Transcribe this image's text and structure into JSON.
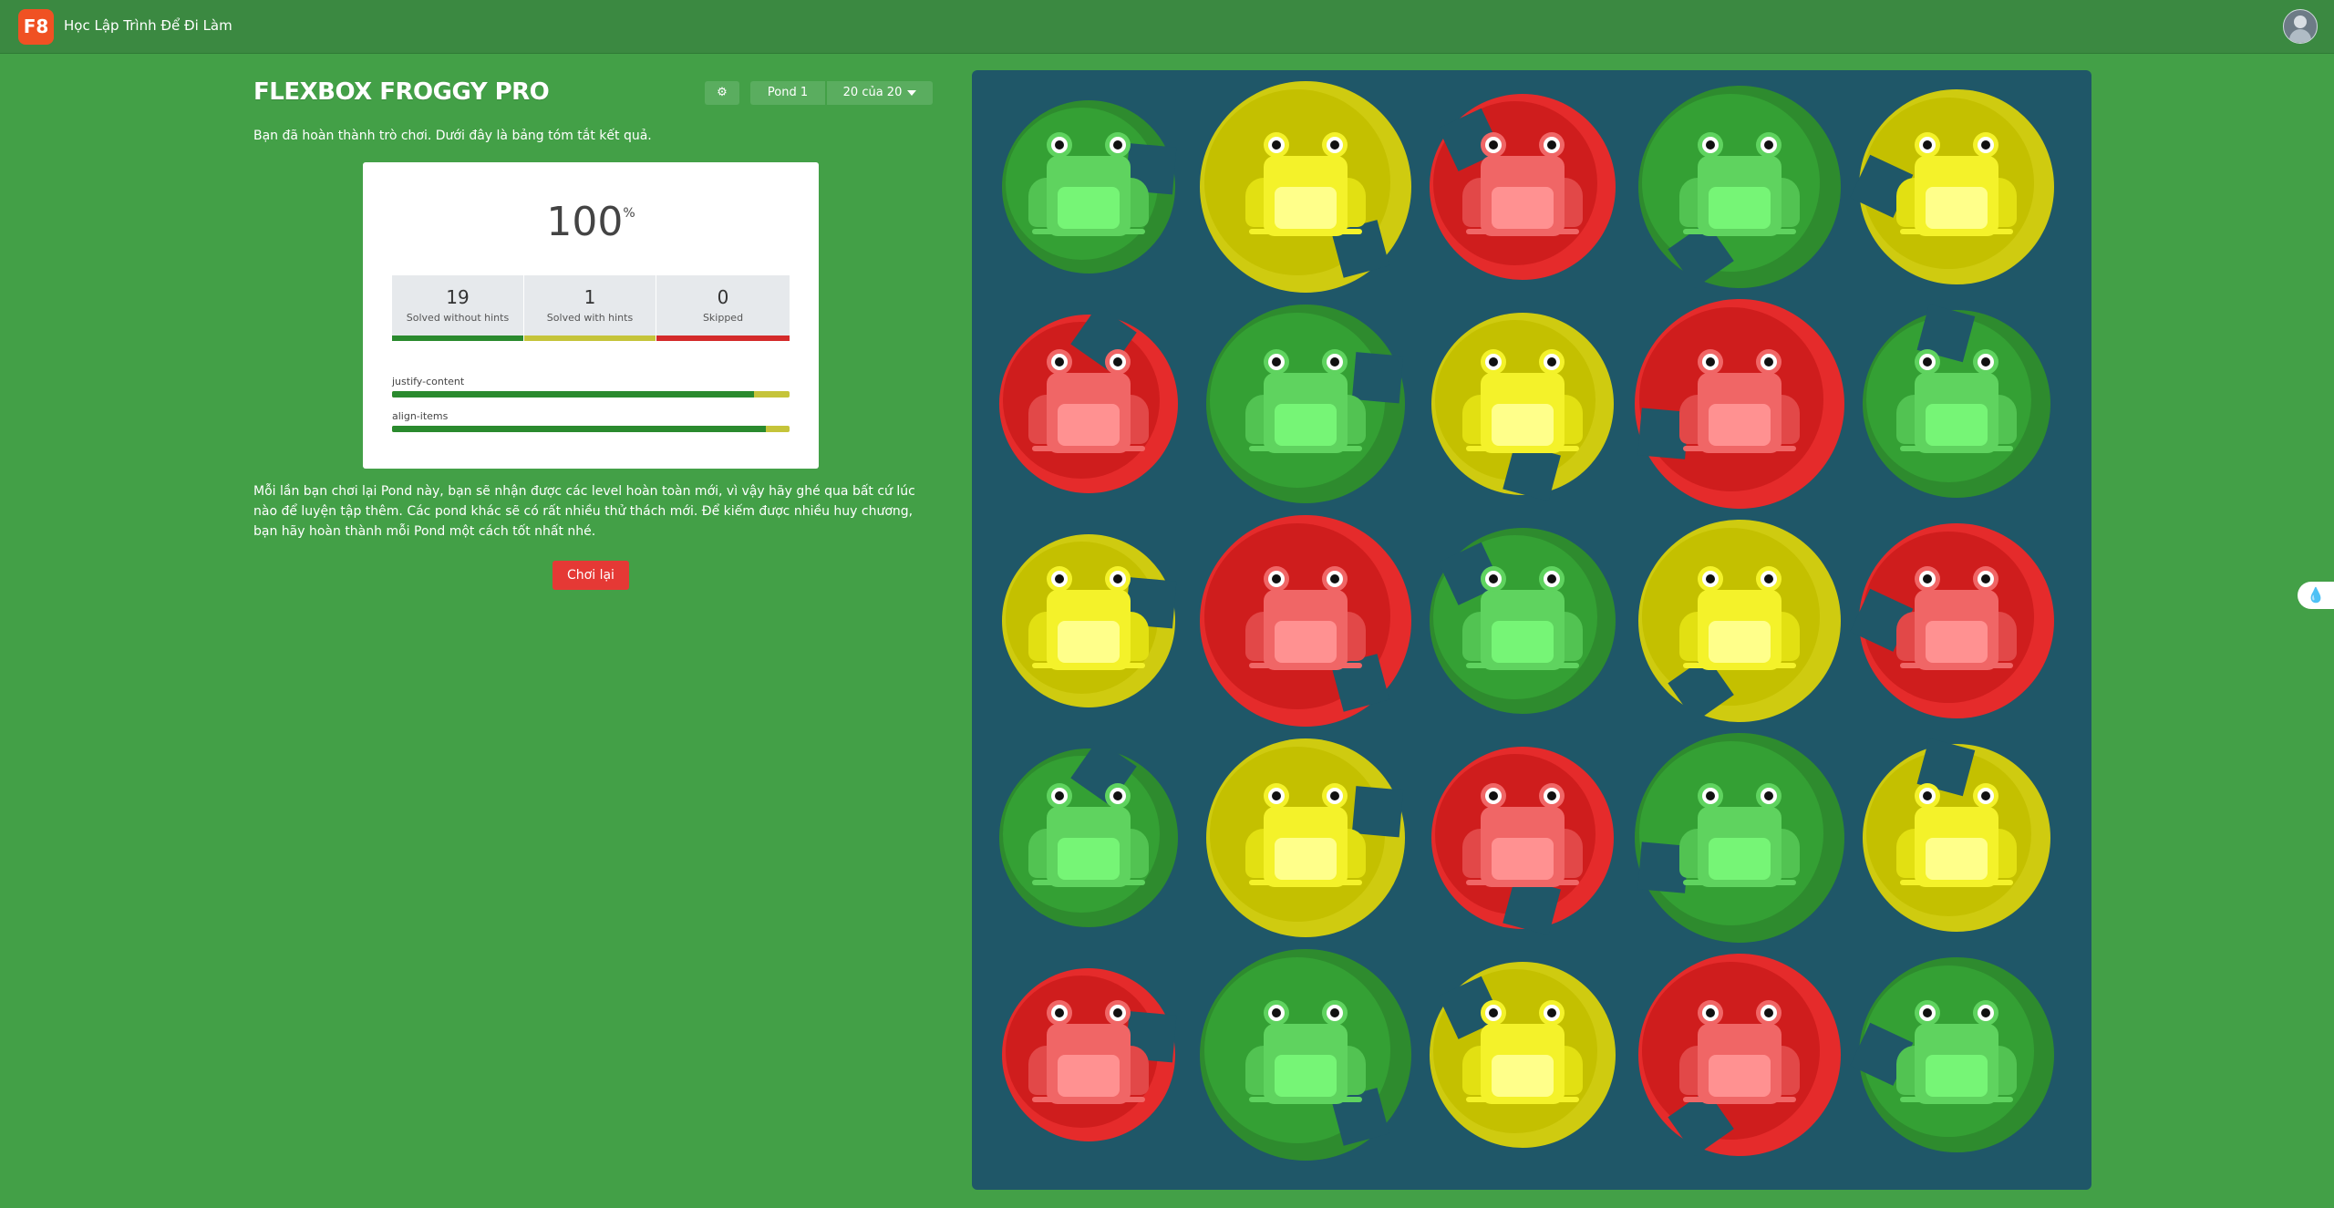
{
  "header": {
    "logo": "F8",
    "site_title": "Học Lập Trình Để Đi Làm"
  },
  "game": {
    "title": "FLEXBOX FROGGY PRO",
    "gear_icon": "⚙",
    "pond_label": "Pond 1",
    "level_label": "20 của 20",
    "intro": "Bạn đã hoàn thành trò chơi. Dưới đây là bảng tóm tắt kết quả.",
    "outro": "Mỗi lần bạn chơi lại Pond này, bạn sẽ nhận được các level hoàn toàn mới, vì vậy hãy ghé qua bất cứ lúc nào để luyện tập thêm. Các pond khác sẽ có rất nhiều thử thách mới. Để kiếm được nhiều huy chương, bạn hãy hoàn thành mỗi Pond một cách tốt nhất nhé.",
    "replay": "Chơi lại"
  },
  "results": {
    "score": "100",
    "score_unit": "%",
    "stats": [
      {
        "value": "19",
        "label": "Solved without hints",
        "color": "#2a8a2e"
      },
      {
        "value": "1",
        "label": "Solved with hints",
        "color": "#c5c43a"
      },
      {
        "value": "0",
        "label": "Skipped",
        "color": "#d42a2a"
      }
    ],
    "properties": [
      {
        "name": "justify-content",
        "fraction_no_hints": 0.91
      },
      {
        "name": "align-items",
        "fraction_no_hints": 0.94
      }
    ]
  },
  "pond": {
    "rows": [
      [
        "green",
        "yellow",
        "red",
        "green",
        "yellow"
      ],
      [
        "red",
        "green",
        "yellow",
        "red",
        "green"
      ],
      [
        "yellow",
        "red",
        "green",
        "yellow",
        "red"
      ],
      [
        "green",
        "yellow",
        "red",
        "green",
        "yellow"
      ],
      [
        "red",
        "green",
        "yellow",
        "red",
        "green"
      ]
    ]
  },
  "widget_icon": "water-drop-icon"
}
